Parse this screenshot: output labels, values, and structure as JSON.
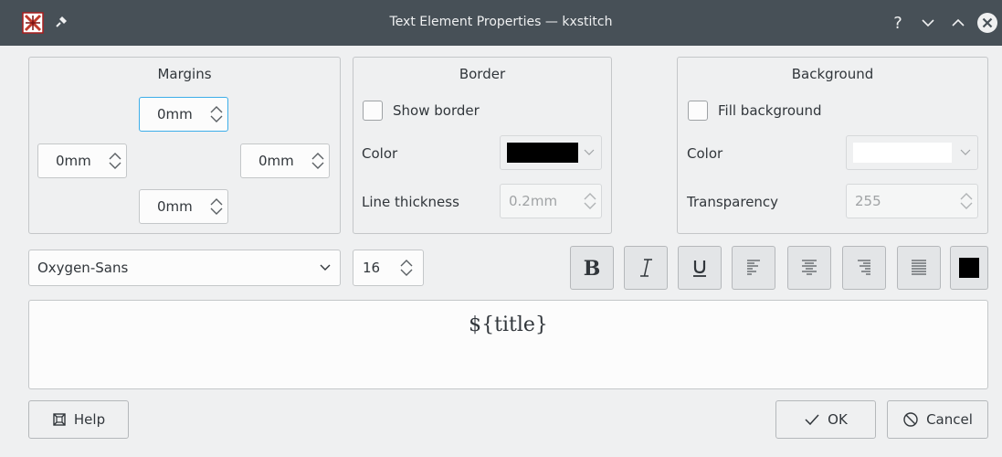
{
  "window": {
    "title": "Text Element Properties — kxstitch",
    "controls": [
      "?",
      "minimize",
      "maximize",
      "close"
    ]
  },
  "margins": {
    "title": "Margins",
    "top": "0mm",
    "left": "0mm",
    "right": "0mm",
    "bottom": "0mm"
  },
  "border": {
    "title": "Border",
    "show_border_label": "Show border",
    "show_border_checked": false,
    "color_label": "Color",
    "color_value": "#000000",
    "thickness_label": "Line thickness",
    "thickness_value": "0.2mm"
  },
  "background": {
    "title": "Background",
    "fill_label": "Fill background",
    "fill_checked": false,
    "color_label": "Color",
    "color_value": "#ffffff",
    "transparency_label": "Transparency",
    "transparency_value": "255"
  },
  "font": {
    "family": "Oxygen-Sans",
    "size": "16"
  },
  "format_toolbar": {
    "bold": "bold-icon",
    "italic": "italic-icon",
    "underline": "underline-icon",
    "align_left": "align-left-icon",
    "align_center": "align-center-icon",
    "align_right": "align-right-icon",
    "justify": "justify-icon",
    "text_color": "#000000"
  },
  "text": {
    "content": "${title}"
  },
  "buttons": {
    "help": "Help",
    "ok": "OK",
    "cancel": "Cancel"
  },
  "colors": {
    "titlebar": "#475057",
    "window_bg": "#eff0f1",
    "focus": "#3daee9"
  }
}
